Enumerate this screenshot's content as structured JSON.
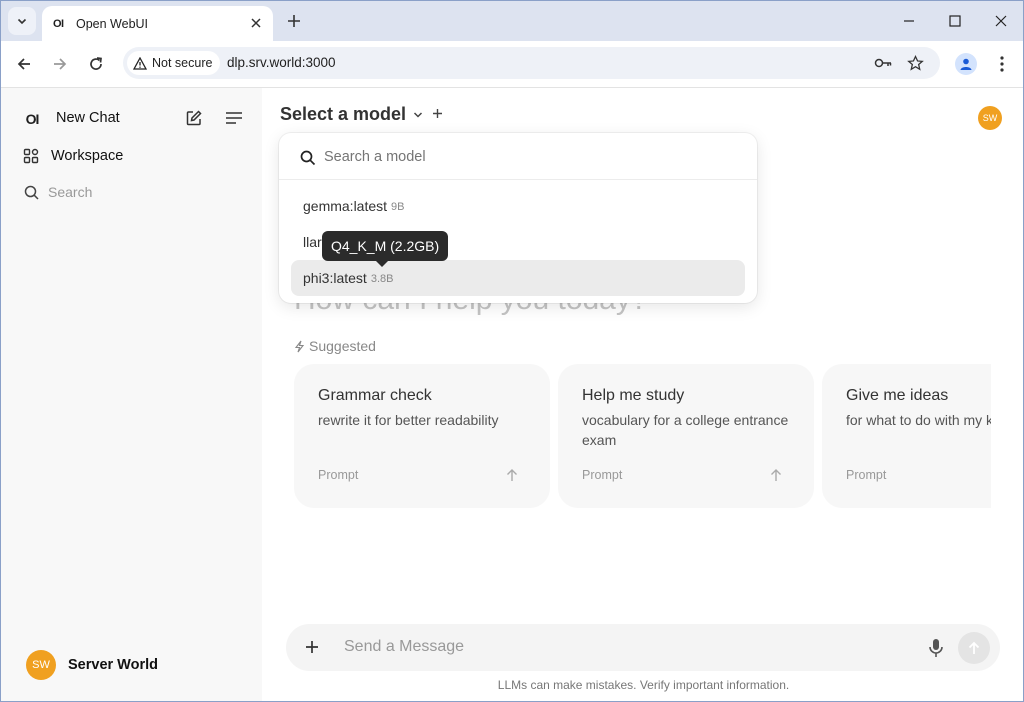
{
  "browser": {
    "tab_title": "Open WebUI",
    "tab_favicon": "OI",
    "security_label": "Not secure",
    "url": "dlp.srv.world:3000"
  },
  "sidebar": {
    "logo": "OI",
    "new_chat_label": "New Chat",
    "workspace_label": "Workspace",
    "search_placeholder": "Search",
    "user": {
      "initials": "SW",
      "name": "Server World"
    }
  },
  "header": {
    "model_selector_label": "Select a model",
    "user_initials": "SW"
  },
  "model_dropdown": {
    "search_placeholder": "Search a model",
    "items": [
      {
        "name": "gemma:latest",
        "size": "9B"
      },
      {
        "name": "llar",
        "size": ""
      },
      {
        "name": "phi3:latest",
        "size": "3.8B"
      }
    ],
    "tooltip": "Q4_K_M (2.2GB)"
  },
  "main": {
    "hero_text": "How can I help you today?",
    "suggested_label": "Suggested",
    "cards": [
      {
        "title": "Grammar check",
        "subtitle": "rewrite it for better readability",
        "prompt_label": "Prompt"
      },
      {
        "title": "Help me study",
        "subtitle": "vocabulary for a college entrance exam",
        "prompt_label": "Prompt"
      },
      {
        "title": "Give me ideas",
        "subtitle": "for what to do with my kids' art",
        "prompt_label": "Prompt"
      }
    ],
    "message_placeholder": "Send a Message",
    "disclaimer": "LLMs can make mistakes. Verify important information."
  },
  "colors": {
    "avatar": "#f0a020",
    "sidebar_bg": "#f8f8f8",
    "tab_strip": "#dde3f0"
  }
}
